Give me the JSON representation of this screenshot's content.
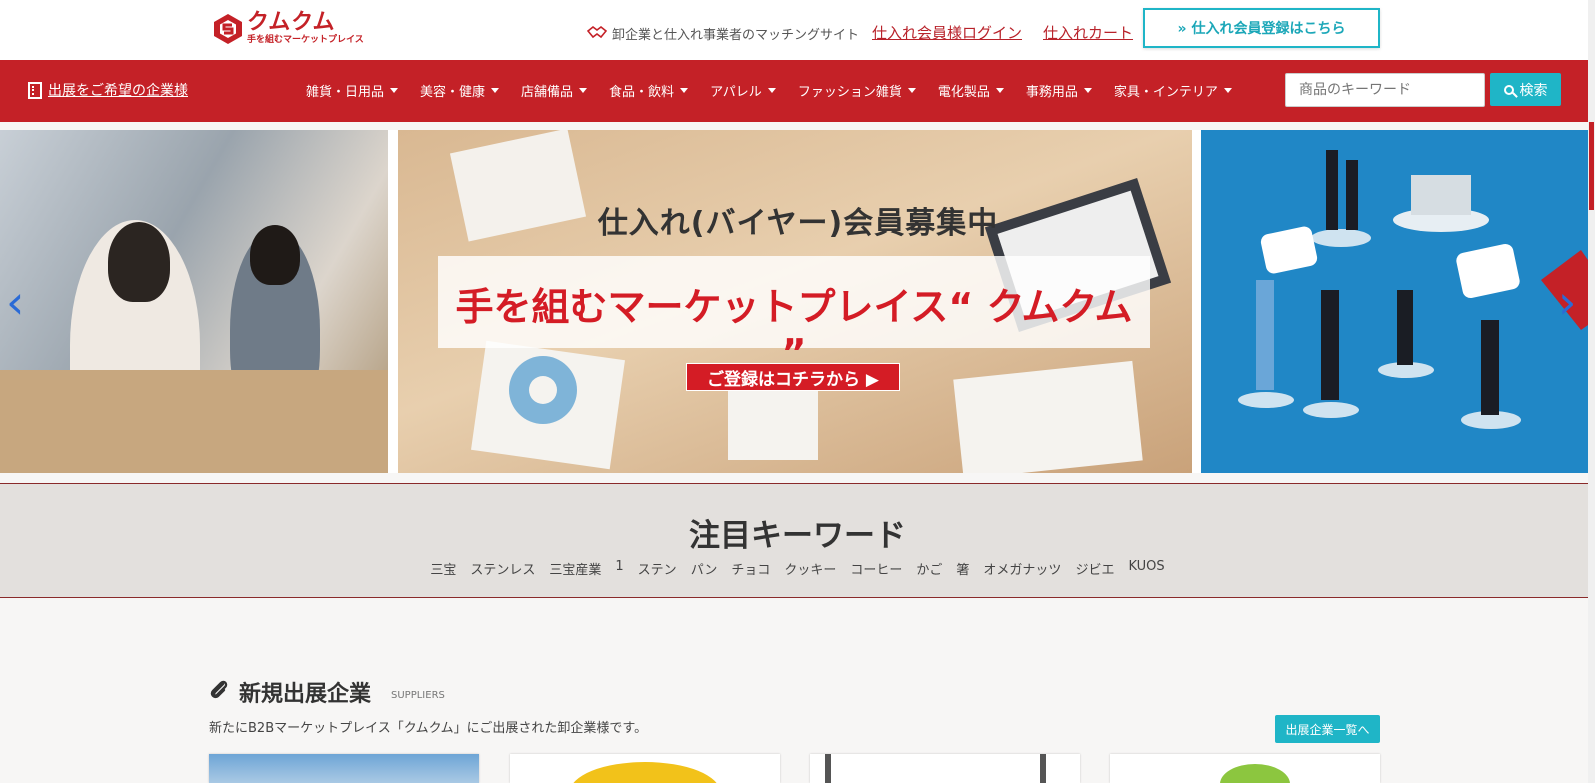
{
  "header": {
    "logo_main": "クムクム",
    "logo_sub": "手を組むマーケットプレイス",
    "tagline": "卸企業と仕入れ事業者のマッチングサイト",
    "login_link": "仕入れ会員様ログイン",
    "cart_link": "仕入れカート",
    "register_button": "» 仕入れ会員登録はこちら"
  },
  "nav": {
    "exhibit_link": "出展をご希望の企業様",
    "categories": [
      "雑貨・日用品",
      "美容・健康",
      "店舗備品",
      "食品・飲料",
      "アパレル",
      "ファッション雑貨",
      "電化製品",
      "事務用品",
      "家具・インテリア"
    ],
    "search_placeholder": "商品のキーワード",
    "search_button": "検索"
  },
  "carousel": {
    "heading": "仕入れ(バイヤー)会員募集中",
    "main_copy": "手を組むマーケットプレイス“ クムクム ”",
    "cta": "ご登録はコチラから ▶",
    "prev_arrow": "‹",
    "next_arrow": "›"
  },
  "keywords": {
    "title": "注目キーワード",
    "items": [
      "三宝",
      "ステンレス",
      "三宝産業",
      "1",
      "ステン",
      "パン",
      "チョコ",
      "クッキー",
      "コーヒー",
      "かご",
      "箸",
      "オメガナッツ",
      "ジビエ",
      "KUOS"
    ]
  },
  "suppliers": {
    "title": "新規出展企業",
    "subtitle": "SUPPLIERS",
    "description": "新たにB2Bマーケットプレイス「クムクム」にご出展された卸企業様です。",
    "list_button": "出展企業一覧へ"
  },
  "colors": {
    "brand_red": "#c42127",
    "accent_teal": "#1fb5c7"
  }
}
